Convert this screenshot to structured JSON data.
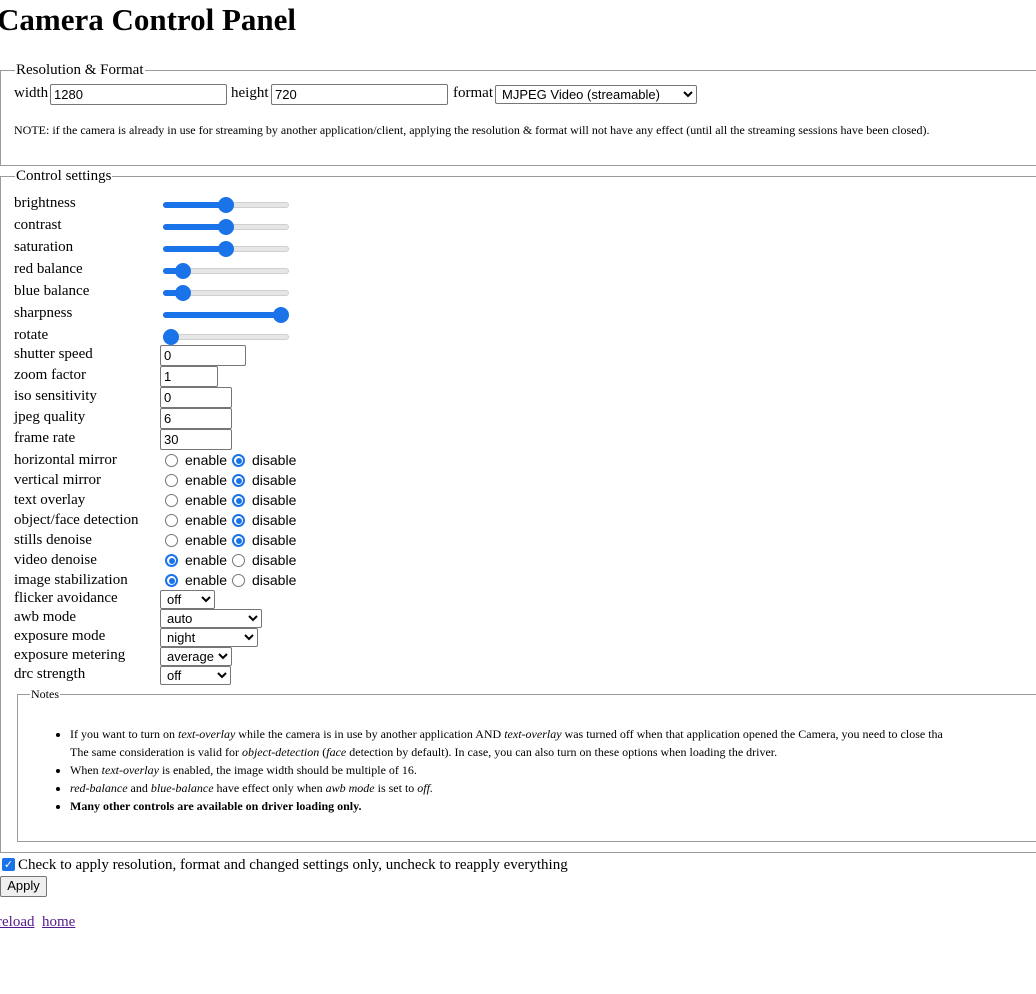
{
  "page_title": "Camera Control Panel",
  "resolution_format": {
    "legend": "Resolution & Format",
    "width_label": "width",
    "width_value": "1280",
    "height_label": "height",
    "height_value": "720",
    "format_label": "format",
    "format_selected": "MJPEG Video (streamable)",
    "note": "NOTE: if the camera is already in use for streaming by another application/client, applying the resolution & format will not have any effect (until all the streaming sessions have been closed)."
  },
  "control_settings": {
    "legend": "Control settings",
    "sliders": [
      {
        "label": "brightness",
        "level": 0.5
      },
      {
        "label": "contrast",
        "level": 0.5
      },
      {
        "label": "saturation",
        "level": 0.5
      },
      {
        "label": "red balance",
        "level": 0.11
      },
      {
        "label": "blue balance",
        "level": 0.11
      },
      {
        "label": "sharpness",
        "level": 1.0
      },
      {
        "label": "rotate",
        "level": 0.0
      }
    ],
    "text_fields": [
      {
        "label": "shutter speed",
        "value": "0"
      },
      {
        "label": "zoom factor",
        "value": "1"
      },
      {
        "label": "iso sensitivity",
        "value": "0"
      },
      {
        "label": "jpeg quality",
        "value": "6"
      },
      {
        "label": "frame rate",
        "value": "30"
      }
    ],
    "enable_label": "enable",
    "disable_label": "disable",
    "toggles": [
      {
        "label": "horizontal mirror",
        "enabled": false
      },
      {
        "label": "vertical mirror",
        "enabled": false
      },
      {
        "label": "text overlay",
        "enabled": false
      },
      {
        "label": "object/face detection",
        "enabled": false
      },
      {
        "label": "stills denoise",
        "enabled": false
      },
      {
        "label": "video denoise",
        "enabled": true
      },
      {
        "label": "image stabilization",
        "enabled": true
      }
    ],
    "selects": [
      {
        "label": "flicker avoidance",
        "selected": "off"
      },
      {
        "label": "awb mode",
        "selected": "auto"
      },
      {
        "label": "exposure mode",
        "selected": "night"
      },
      {
        "label": "exposure metering",
        "selected": "average"
      },
      {
        "label": "drc strength",
        "selected": "off"
      }
    ],
    "notes": {
      "legend": "Notes",
      "items": [
        {
          "parts": [
            {
              "t": "If you want to turn on ",
              "i": false
            },
            {
              "t": "text-overlay",
              "i": true
            },
            {
              "t": " while the camera is in use by another application AND ",
              "i": false
            },
            {
              "t": "text-overlay",
              "i": true
            },
            {
              "t": " was turned off when that application opened the Camera, you need to close tha",
              "i": false
            }
          ],
          "parts2": [
            {
              "t": "The same consideration is valid for ",
              "i": false
            },
            {
              "t": "object-detection",
              "i": true
            },
            {
              "t": " (",
              "i": false
            },
            {
              "t": "face",
              "i": true
            },
            {
              "t": " detection by default). In case, you can also turn on these options when loading the driver.",
              "i": false
            }
          ]
        },
        {
          "parts": [
            {
              "t": "When ",
              "i": false
            },
            {
              "t": "text-overlay",
              "i": true
            },
            {
              "t": " is enabled, the image width should be multiple of 16.",
              "i": false
            }
          ]
        },
        {
          "parts": [
            {
              "t": "red-balance",
              "i": true
            },
            {
              "t": " and ",
              "i": false
            },
            {
              "t": "blue-balance",
              "i": true
            },
            {
              "t": " have effect only when ",
              "i": false
            },
            {
              "t": "awb mode",
              "i": true
            },
            {
              "t": " is set to ",
              "i": false
            },
            {
              "t": "off.",
              "i": true
            }
          ]
        },
        {
          "parts": [
            {
              "t": "Many other controls are available on driver loading only.",
              "i": false,
              "b": true
            }
          ]
        }
      ]
    }
  },
  "apply_changed_only": {
    "checked": true,
    "label": "Check to apply resolution, format and changed settings only, uncheck to reapply everything"
  },
  "apply_button": "Apply",
  "links": {
    "reload": "reload",
    "home": "home"
  },
  "colors": {
    "accent": "#1a73e8",
    "visited_link": "#551a8b",
    "border": "#9a9a9a"
  }
}
